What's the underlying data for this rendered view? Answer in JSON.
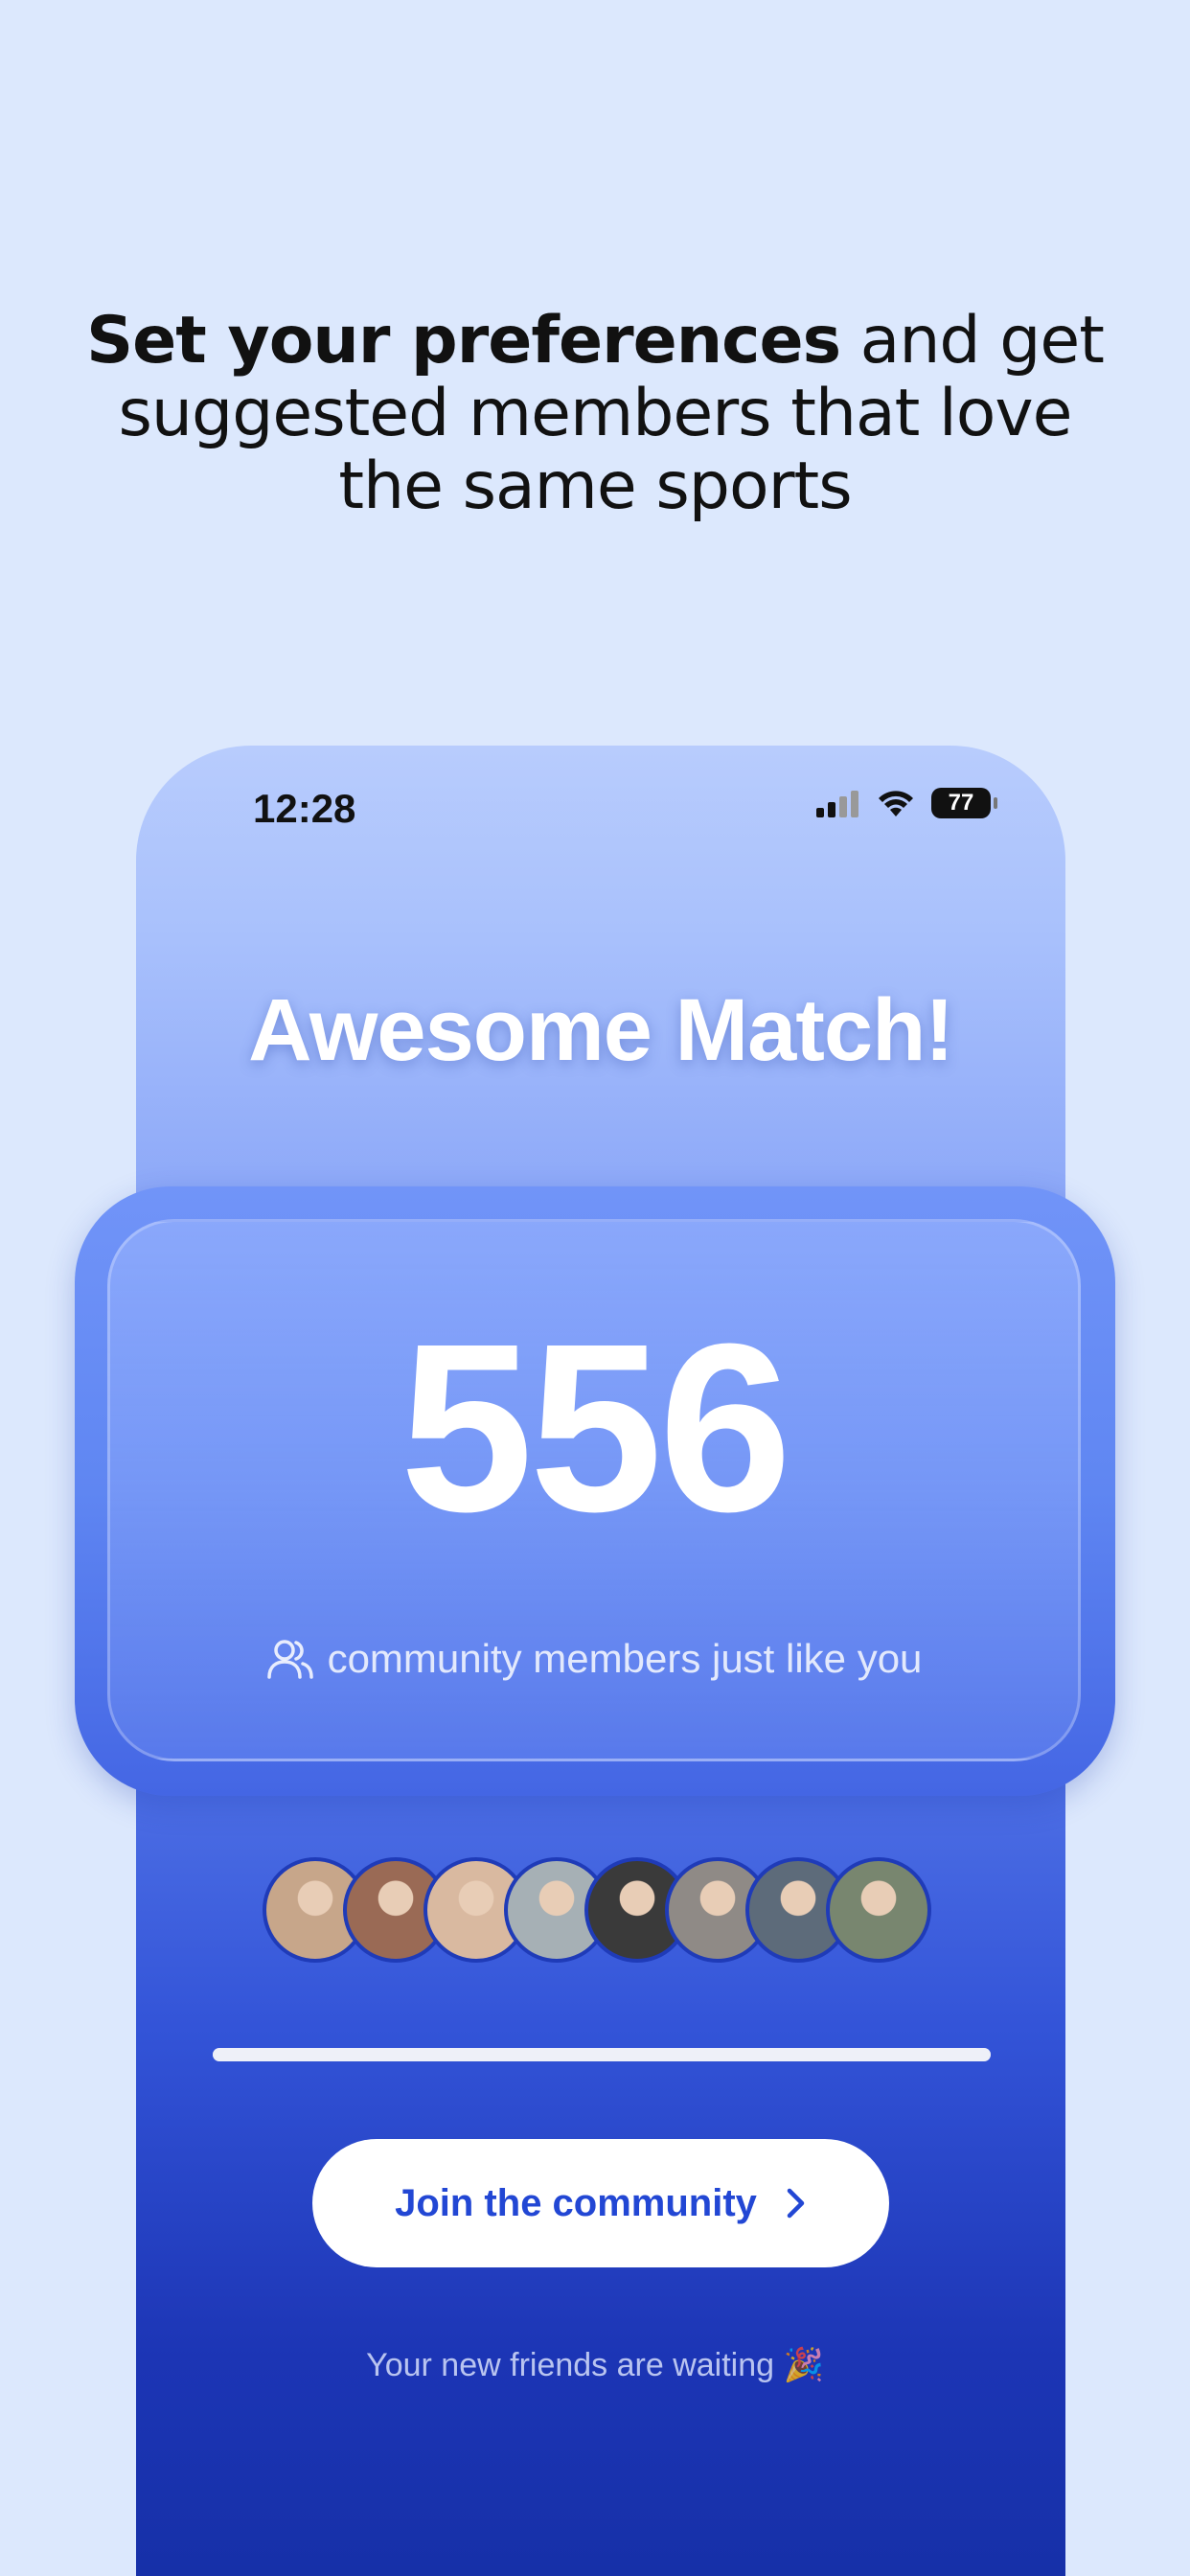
{
  "headline": {
    "bold": "Set your preferences",
    "rest": " and get suggested members that love the same sports"
  },
  "status_bar": {
    "time": "12:28",
    "battery": "77"
  },
  "title": "Awesome Match!",
  "match_count": "556",
  "members_caption": "community members just like you",
  "progress": 1.0,
  "avatars": [
    {
      "color": "#c7a68a"
    },
    {
      "color": "#9a6a55"
    },
    {
      "color": "#d9b9a0"
    },
    {
      "color": "#a6b0b5"
    },
    {
      "color": "#3a3a3a"
    },
    {
      "color": "#8f8a86"
    },
    {
      "color": "#5d6b7a"
    },
    {
      "color": "#78866f"
    }
  ],
  "cta": {
    "label": "Join the community"
  },
  "footnote": "Your new friends are waiting 🎉",
  "colors": {
    "accent": "#2247d4",
    "background": "#dce8fd"
  }
}
